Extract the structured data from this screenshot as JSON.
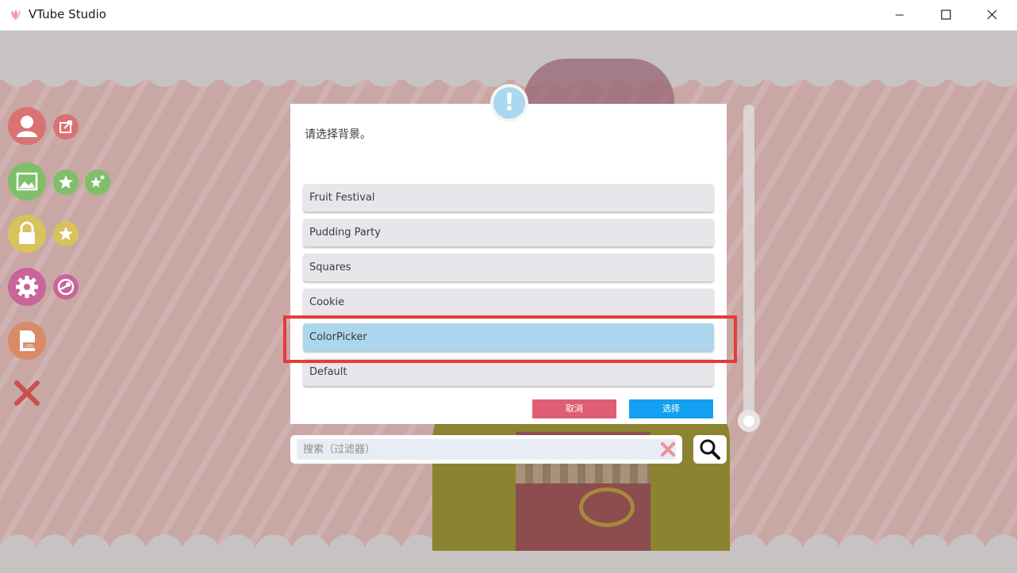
{
  "window": {
    "title": "VTube Studio",
    "controls": [
      "minimize-icon",
      "maximize-icon",
      "close-icon"
    ]
  },
  "sidebar": {
    "buttons": [
      {
        "name": "model-button",
        "icon": "person-icon",
        "color": "#d97373"
      },
      {
        "name": "share-model-button",
        "icon": "share-icon",
        "color": "#d97373"
      },
      {
        "name": "background-button",
        "icon": "image-icon",
        "color": "#7fbf6a"
      },
      {
        "name": "favorite-background-button",
        "icon": "star-icon",
        "color": "#7fbf6a"
      },
      {
        "name": "favorites-button",
        "icon": "stars-icon",
        "color": "#7fbf6a"
      },
      {
        "name": "lock-button",
        "icon": "lock-icon",
        "color": "#d8c25a"
      },
      {
        "name": "favorite-lock-button",
        "icon": "star-icon",
        "color": "#d8c25a"
      },
      {
        "name": "settings-button",
        "icon": "gear-icon",
        "color": "#c8659b"
      },
      {
        "name": "steam-button",
        "icon": "steam-icon",
        "color": "#c8659b"
      },
      {
        "name": "log-button",
        "icon": "log-icon",
        "color": "#d98a66"
      },
      {
        "name": "exit-button",
        "icon": "x-icon",
        "color": "#c9504f"
      }
    ]
  },
  "dialog": {
    "icon": "exclamation-icon",
    "alert_glyph": "!",
    "message": "请选择背景。",
    "options": [
      {
        "label": "Fruit Festival",
        "selected": false
      },
      {
        "label": "Pudding Party",
        "selected": false
      },
      {
        "label": "Squares",
        "selected": false
      },
      {
        "label": "Cookie",
        "selected": false
      },
      {
        "label": "ColorPicker",
        "selected": true
      },
      {
        "label": "Default",
        "selected": false
      }
    ],
    "cancel_label": "取消",
    "select_label": "选择",
    "colors": {
      "cancel": "#df5e74",
      "select": "#13a0f2",
      "selected_option": "#acd6ee",
      "option": "#e8e6ea"
    }
  },
  "search": {
    "placeholder": "搜索（过滤器）",
    "value": "",
    "clear_icon": "clear-x-icon",
    "button_icon": "magnifier-icon"
  },
  "highlight": {
    "color": "#e83a3a",
    "target": "ColorPicker"
  }
}
